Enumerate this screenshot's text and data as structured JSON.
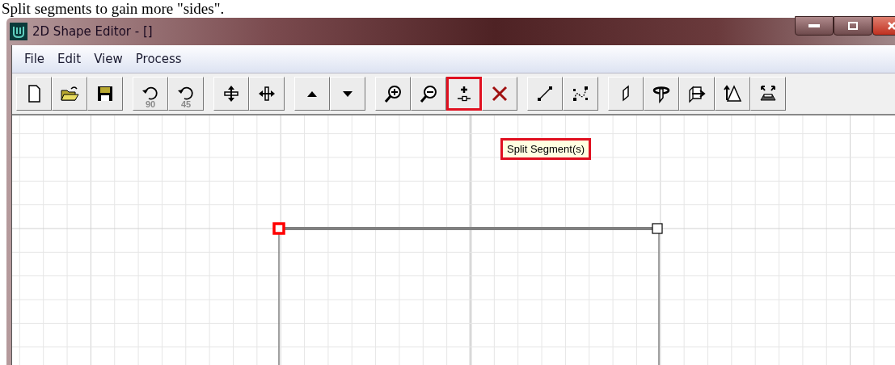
{
  "caption": "Split segments to gain more \"sides\".",
  "window": {
    "title": "2D Shape Editor - []"
  },
  "menu": [
    {
      "label": "File"
    },
    {
      "label": "Edit"
    },
    {
      "label": "View"
    },
    {
      "label": "Process"
    }
  ],
  "toolbar_groups": [
    [
      {
        "kind": "new",
        "highlighted": false
      },
      {
        "kind": "open",
        "highlighted": false
      },
      {
        "kind": "save",
        "highlighted": false
      }
    ],
    [
      {
        "kind": "rotate",
        "label": "90",
        "highlighted": false
      },
      {
        "kind": "rotate",
        "label": "45",
        "highlighted": false
      }
    ],
    [
      {
        "kind": "flip-vertical",
        "highlighted": false
      },
      {
        "kind": "flip-horizontal",
        "highlighted": false
      }
    ],
    [
      {
        "kind": "up",
        "highlighted": false
      },
      {
        "kind": "down",
        "highlighted": false
      }
    ],
    [
      {
        "kind": "zoom-in",
        "highlighted": false
      },
      {
        "kind": "zoom-out",
        "highlighted": false
      },
      {
        "kind": "split",
        "highlighted": true
      },
      {
        "kind": "delete",
        "highlighted": false
      }
    ],
    [
      {
        "kind": "line",
        "highlighted": false
      },
      {
        "kind": "curve",
        "highlighted": false
      }
    ],
    [
      {
        "kind": "sheet",
        "highlighted": false
      },
      {
        "kind": "revolve",
        "highlighted": false
      },
      {
        "kind": "extrude",
        "highlighted": false
      },
      {
        "kind": "extrude-point",
        "highlighted": false
      },
      {
        "kind": "bevel",
        "highlighted": false
      }
    ]
  ],
  "tooltip": {
    "text": "Split Segment(s)",
    "highlighted": true
  },
  "vertices": [
    {
      "selected": true
    },
    {
      "selected": false
    }
  ]
}
